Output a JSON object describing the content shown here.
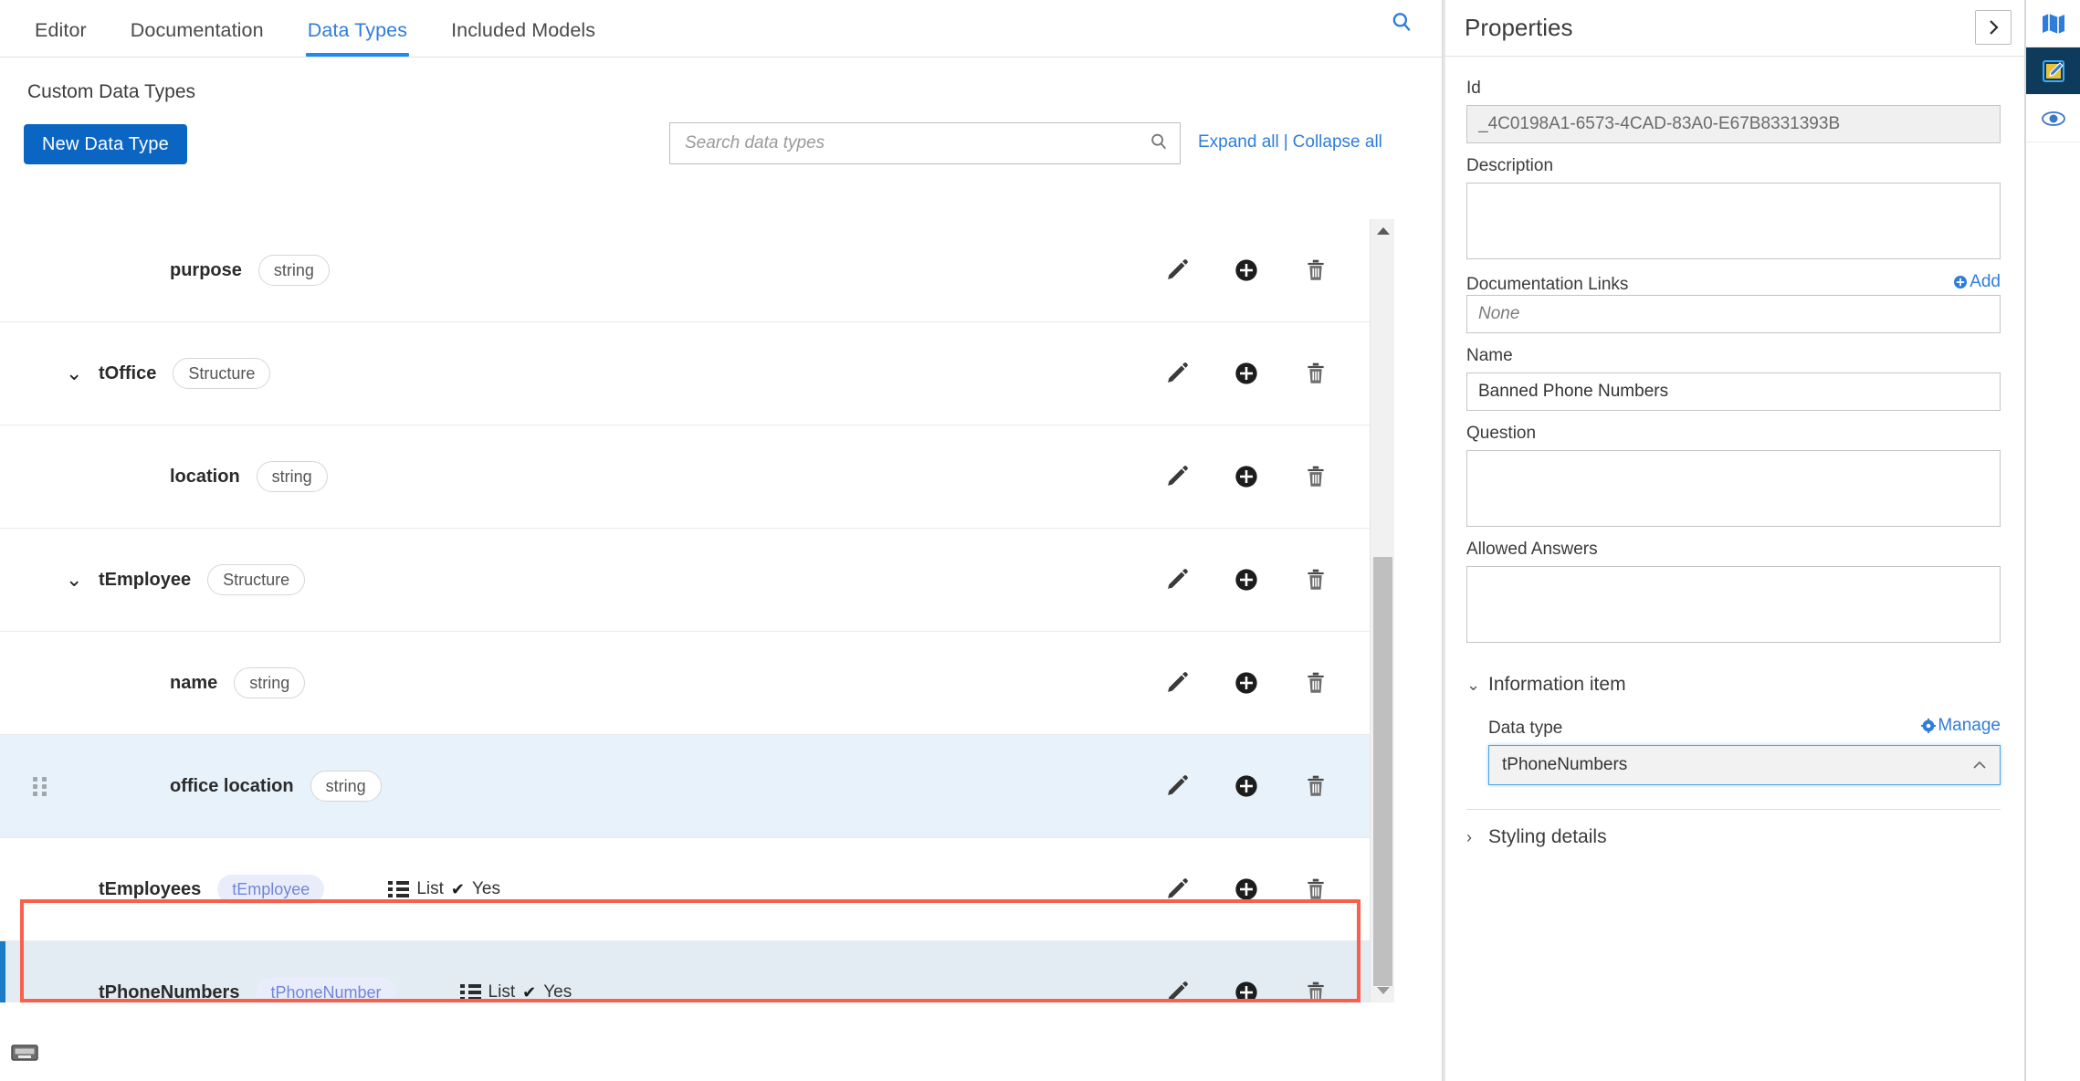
{
  "tabs": [
    {
      "label": "Editor",
      "active": false
    },
    {
      "label": "Documentation",
      "active": false
    },
    {
      "label": "Data Types",
      "active": true
    },
    {
      "label": "Included Models",
      "active": false
    }
  ],
  "main": {
    "section_title": "Custom Data Types",
    "new_button": "New Data Type",
    "search_placeholder": "Search data types",
    "search_value": "",
    "expand_all": "Expand all",
    "links_separator": "|",
    "collapse_all": "Collapse all"
  },
  "rows": [
    {
      "name": "purpose",
      "type_chip": "string",
      "chip_style": "plain",
      "indent": 2,
      "caret": "",
      "list_label": "",
      "list_value": "",
      "selected": false,
      "drag_handle": false,
      "highlighted": false
    },
    {
      "name": "tOffice",
      "type_chip": "Structure",
      "chip_style": "plain",
      "indent": 1,
      "caret": "⌄",
      "list_label": "",
      "list_value": "",
      "selected": false,
      "drag_handle": false,
      "highlighted": false
    },
    {
      "name": "location",
      "type_chip": "string",
      "chip_style": "plain",
      "indent": 2,
      "caret": "",
      "list_label": "",
      "list_value": "",
      "selected": false,
      "drag_handle": false,
      "highlighted": false
    },
    {
      "name": "tEmployee",
      "type_chip": "Structure",
      "chip_style": "plain",
      "indent": 1,
      "caret": "⌄",
      "list_label": "",
      "list_value": "",
      "selected": false,
      "drag_handle": false,
      "highlighted": false
    },
    {
      "name": "name",
      "type_chip": "string",
      "chip_style": "plain",
      "indent": 2,
      "caret": "",
      "list_label": "",
      "list_value": "",
      "selected": false,
      "drag_handle": false,
      "highlighted": false
    },
    {
      "name": "office location",
      "type_chip": "string",
      "chip_style": "plain",
      "indent": 2,
      "caret": "",
      "list_label": "",
      "list_value": "",
      "selected": true,
      "drag_handle": true,
      "highlighted": false
    },
    {
      "name": "tEmployees",
      "type_chip": "tEmployee",
      "chip_style": "ref",
      "indent": 1,
      "caret": "",
      "list_label": "List",
      "list_value": "Yes",
      "selected": false,
      "drag_handle": false,
      "highlighted": false
    },
    {
      "name": "tPhoneNumbers",
      "type_chip": "tPhoneNumber",
      "chip_style": "ref",
      "indent": 1,
      "caret": "",
      "list_label": "List",
      "list_value": "Yes",
      "selected": true,
      "drag_handle": false,
      "highlighted": true
    }
  ],
  "row_actions": {
    "edit": "edit-icon",
    "add": "add-icon",
    "delete": "delete-icon"
  },
  "icons": {
    "tabbar_search": "search-icon",
    "row_search": "search-icon",
    "keyboard": "keyboard-icon",
    "scroll_up": "▲",
    "scroll_down": "▼",
    "collapse_panel": "❯",
    "rail": [
      {
        "name": "map-icon",
        "active": false
      },
      {
        "name": "edit-model-icon",
        "active": true
      },
      {
        "name": "eye-preview-icon",
        "active": false
      }
    ]
  },
  "properties": {
    "title": "Properties",
    "id_label": "Id",
    "id_value": "_4C0198A1-6573-4CAD-83A0-E67B8331393B",
    "description_label": "Description",
    "description_value": "",
    "doc_links_label": "Documentation Links",
    "doc_links_add": "Add",
    "doc_links_placeholder": "None",
    "doc_links_value": "",
    "name_label": "Name",
    "name_value": "Banned Phone Numbers",
    "question_label": "Question",
    "question_value": "",
    "allowed_answers_label": "Allowed Answers",
    "allowed_answers_value": "",
    "information_item_label": "Information item",
    "data_type_label": "Data type",
    "manage_label": "Manage",
    "data_type_value": "tPhoneNumbers",
    "data_type_caret": "⌃",
    "styling_details_label": "Styling details",
    "information_item_caret": "⌄",
    "styling_details_caret": "›"
  },
  "colors": {
    "accent": "#1d8bf1",
    "primary_button": "#0b66c3",
    "highlight_border": "#f9604b",
    "selected_row": "#e8f2fb",
    "rail_active": "#0e3a5c",
    "link": "#2f7ddb"
  }
}
